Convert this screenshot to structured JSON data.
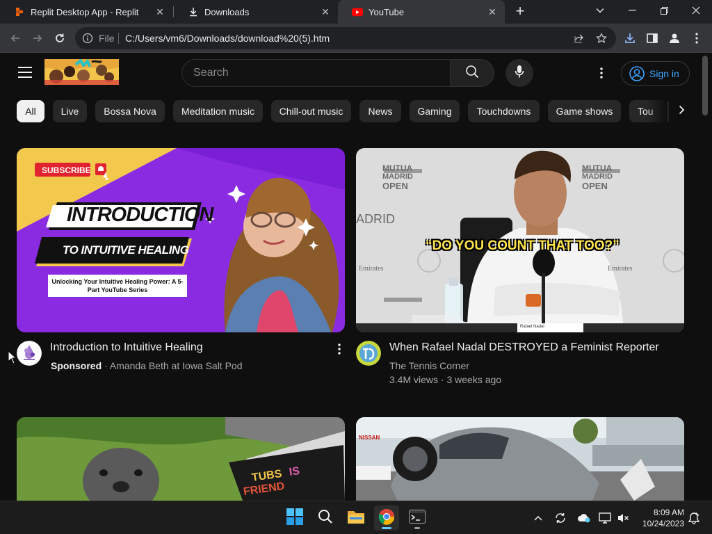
{
  "browser": {
    "tabs": [
      {
        "title": "Replit Desktop App - Replit",
        "icon": "replit-icon"
      },
      {
        "title": "Downloads",
        "icon": "download-icon"
      },
      {
        "title": "YouTube",
        "icon": "youtube-icon",
        "active": true
      }
    ],
    "address": {
      "scheme_label": "File",
      "url": "C:/Users/vm6/Downloads/download%20(5).htm"
    }
  },
  "youtube": {
    "search": {
      "placeholder": "Search"
    },
    "signin_label": "Sign in",
    "chips": [
      "All",
      "Live",
      "Bossa Nova",
      "Meditation music",
      "Chill-out music",
      "News",
      "Gaming",
      "Touchdowns",
      "Game shows",
      "Tou"
    ],
    "videos": [
      {
        "title": "Introduction to Intuitive Healing",
        "sponsored_label": "Sponsored",
        "separator": "·",
        "channel": "Amanda Beth at Iowa Salt Pod",
        "thumb": {
          "subscribe": "SUBSCRIBE",
          "line1": "INTRODUCTION",
          "line2": "TO INTUITIVE HEALING",
          "line3": "Unlocking Your Intuitive Healing Power: A 5-Part YouTube Series"
        }
      },
      {
        "title": "When Rafael Nadal DESTROYED a Feminist Reporter",
        "channel": "The Tennis Corner",
        "views": "3.4M views",
        "separator": "·",
        "age": "3 weeks ago",
        "thumb": {
          "caption": "“DO YOU COUNT THAT TOO?”",
          "brand1": "MUTUA",
          "brand2": "MADRID",
          "brand3": "OPEN",
          "side_left": "ADRID",
          "sponsor": "Emirates",
          "nameplate": "Rafael Nadal"
        }
      },
      {
        "thumb": {
          "sign_text1": "TUBS",
          "sign_text2": "IS",
          "sign_text3": "FRIEND"
        }
      },
      {
        "thumb": {
          "sign": "NISSAN"
        }
      }
    ]
  },
  "taskbar": {
    "apps": [
      "windows-start",
      "search",
      "file-explorer",
      "chrome",
      "terminal"
    ],
    "time": "8:09 AM",
    "date": "10/24/2023"
  },
  "colors": {
    "yt_bg": "#0f0f0f",
    "chip_bg": "#272727",
    "link_blue": "#3ea6ff",
    "purple_thumb": "#8a2be2"
  }
}
